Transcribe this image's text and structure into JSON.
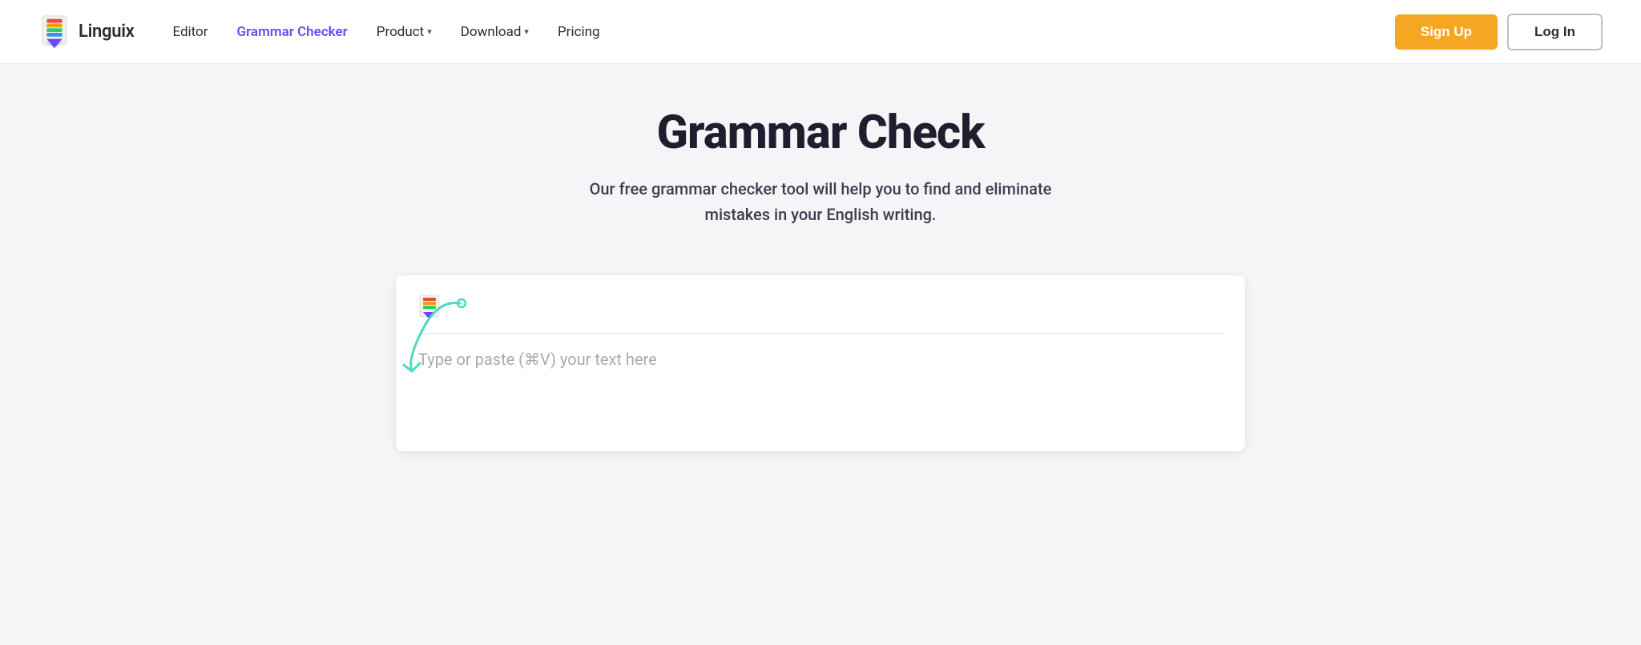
{
  "brand": {
    "name": "Linguix",
    "logo_alt": "Linguix logo"
  },
  "navbar": {
    "links": [
      {
        "id": "editor",
        "label": "Editor",
        "active": false,
        "has_dropdown": false
      },
      {
        "id": "grammar-checker",
        "label": "Grammar Checker",
        "active": true,
        "has_dropdown": false
      },
      {
        "id": "product",
        "label": "Product",
        "active": false,
        "has_dropdown": true
      },
      {
        "id": "download",
        "label": "Download",
        "active": false,
        "has_dropdown": true
      },
      {
        "id": "pricing",
        "label": "Pricing",
        "active": false,
        "has_dropdown": false
      }
    ],
    "signup_label": "Sign Up",
    "login_label": "Log In"
  },
  "hero": {
    "title": "Grammar Check",
    "subtitle": "Our free grammar checker tool will help you to find and eliminate mistakes in your English writing."
  },
  "editor": {
    "placeholder": "Type or paste (⌘V) your text here"
  },
  "colors": {
    "active_link": "#6c47ff",
    "signup_bg": "#f5a623",
    "arrow_color": "#4dd9c0"
  }
}
